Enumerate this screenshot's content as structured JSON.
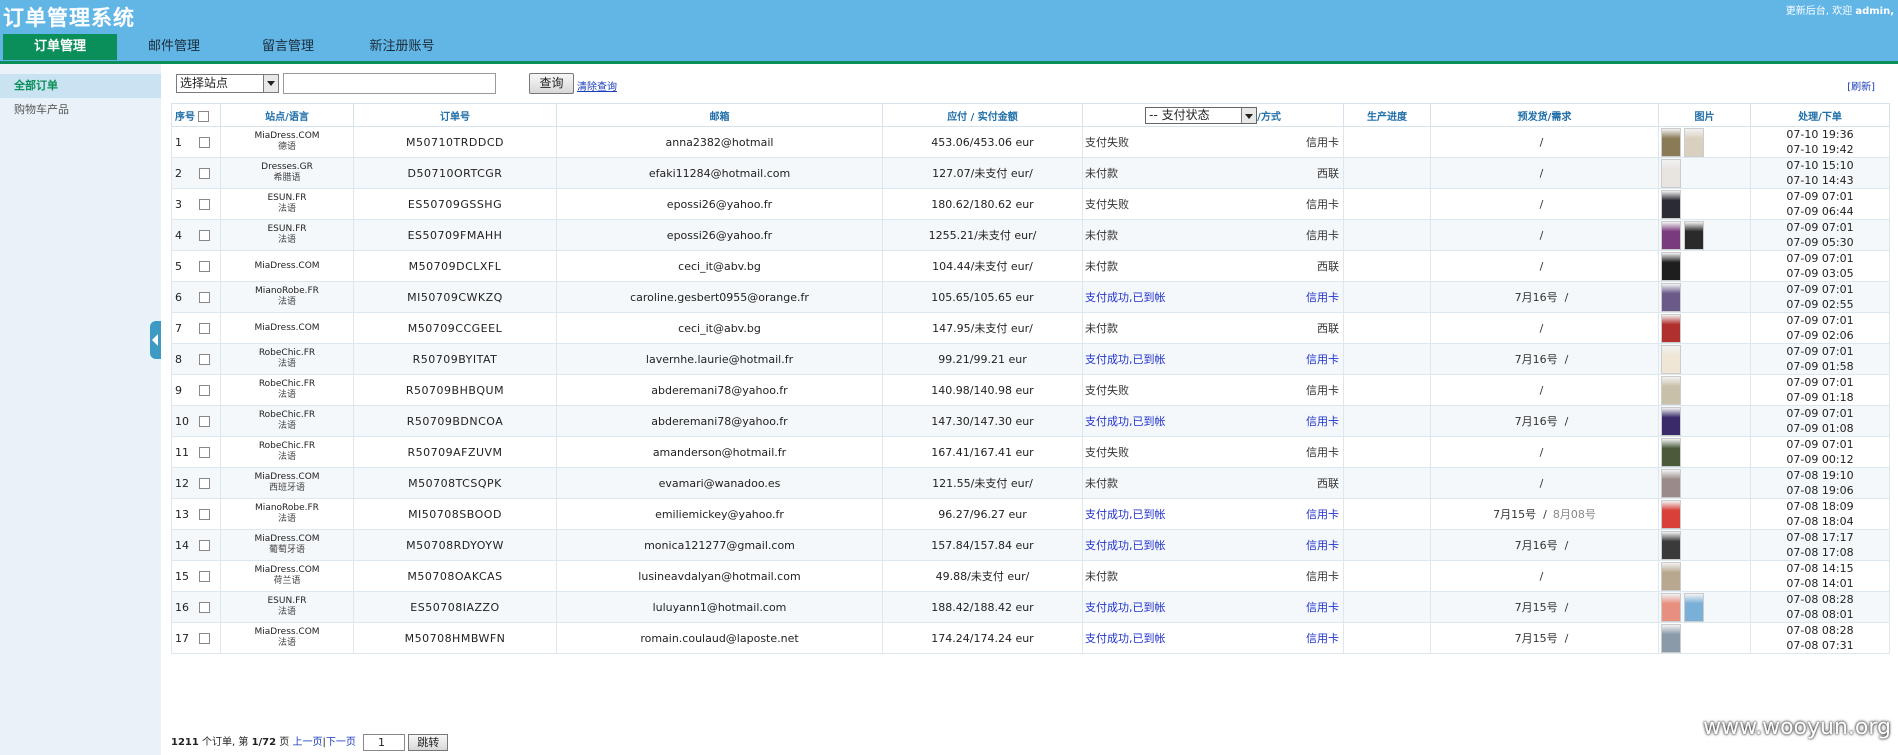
{
  "app": {
    "title": "订单管理系统",
    "top_right_prefix": "更新后台,  欢迎",
    "user": "admin,"
  },
  "nav": {
    "tabs": [
      "订单管理",
      "邮件管理",
      "留言管理",
      "新注册账号"
    ]
  },
  "sidebar": {
    "items": [
      "全部订单",
      "购物车产品"
    ]
  },
  "toolbar": {
    "site_select": "选择站点",
    "search_value": "",
    "query_button": "查询",
    "clear_link": "清除查询",
    "refresh_link": "[刷新]"
  },
  "table": {
    "headers": {
      "seq": "序号",
      "site": "站点/语言",
      "order_no": "订单号",
      "email": "邮箱",
      "amount": "应付 / 实付金额",
      "pay_status_select": "-- 支付状态",
      "pay_method": "/方式",
      "progress": "生产进度",
      "ship": "预发货/需求",
      "images": "图片",
      "time": "处理/下单"
    },
    "rows": [
      {
        "seq": "1",
        "site": "MiaDress.COM",
        "lang": "德语",
        "order_no": "M50710TRDDCD",
        "email": "anna2382@hotmail",
        "amount": "453.06/453.06 eur",
        "pay_status": "支付失败",
        "pay_method": "信用卡",
        "ok": false,
        "ship": "/",
        "ship_est": "",
        "thumbs": [
          "#8a7a55",
          "#d9d0c0"
        ],
        "time1": "07-10 19:36",
        "time2": "07-10 19:42"
      },
      {
        "seq": "2",
        "site": "Dresses.GR",
        "lang": "希腊语",
        "order_no": "D50710ORTCGR",
        "email": "efaki11284@hotmail.com",
        "amount": "127.07/未支付 eur/",
        "pay_status": "未付款",
        "pay_method": "西联",
        "ok": false,
        "ship": "/",
        "ship_est": "",
        "thumbs": [
          "#e8e4e0"
        ],
        "time1": "07-10 15:10",
        "time2": "07-10 14:43"
      },
      {
        "seq": "3",
        "site": "ESUN.FR",
        "lang": "法语",
        "order_no": "ES50709GSSHG",
        "email": "epossi26@yahoo.fr",
        "amount": "180.62/180.62 eur",
        "pay_status": "支付失败",
        "pay_method": "信用卡",
        "ok": false,
        "ship": "/",
        "ship_est": "",
        "thumbs": [
          "#2b2b33"
        ],
        "time1": "07-09 07:01",
        "time2": "07-09 06:44"
      },
      {
        "seq": "4",
        "site": "ESUN.FR",
        "lang": "法语",
        "order_no": "ES50709FMAHH",
        "email": "epossi26@yahoo.fr",
        "amount": "1255.21/未支付 eur/",
        "pay_status": "未付款",
        "pay_method": "信用卡",
        "ok": false,
        "ship": "/",
        "ship_est": "",
        "thumbs": [
          "#7a3a7e",
          "#2a2a2a"
        ],
        "time1": "07-09 07:01",
        "time2": "07-09 05:30"
      },
      {
        "seq": "5",
        "site": "MiaDress.COM",
        "lang": "",
        "order_no": "M50709DCLXFL",
        "email": "ceci_it@abv.bg",
        "amount": "104.44/未支付 eur/",
        "pay_status": "未付款",
        "pay_method": "西联",
        "ok": false,
        "ship": "/",
        "ship_est": "",
        "thumbs": [
          "#1e1e1e"
        ],
        "time1": "07-09 07:01",
        "time2": "07-09 03:05"
      },
      {
        "seq": "6",
        "site": "MianoRobe.FR",
        "lang": "法语",
        "order_no": "MI50709CWKZQ",
        "email": "caroline.gesbert0955@orange.fr",
        "amount": "105.65/105.65 eur",
        "pay_status": "支付成功,已到帐",
        "pay_method": "信用卡",
        "ok": true,
        "ship": "7月16号",
        "ship_est": "",
        "thumbs": [
          "#6a5a8a"
        ],
        "time1": "07-09 07:01",
        "time2": "07-09 02:55"
      },
      {
        "seq": "7",
        "site": "MiaDress.COM",
        "lang": "",
        "order_no": "M50709CCGEEL",
        "email": "ceci_it@abv.bg",
        "amount": "147.95/未支付 eur/",
        "pay_status": "未付款",
        "pay_method": "西联",
        "ok": false,
        "ship": "/",
        "ship_est": "",
        "thumbs": [
          "#b0302e"
        ],
        "time1": "07-09 07:01",
        "time2": "07-09 02:06"
      },
      {
        "seq": "8",
        "site": "RobeChic.FR",
        "lang": "法语",
        "order_no": "R50709BYITAT",
        "email": "lavernhe.laurie@hotmail.fr",
        "amount": "99.21/99.21 eur",
        "pay_status": "支付成功,已到帐",
        "pay_method": "信用卡",
        "ok": true,
        "ship": "7月16号",
        "ship_est": "",
        "thumbs": [
          "#efe6d6"
        ],
        "time1": "07-09 07:01",
        "time2": "07-09 01:58"
      },
      {
        "seq": "9",
        "site": "RobeChic.FR",
        "lang": "法语",
        "order_no": "R50709BHBQUM",
        "email": "abderemani78@yahoo.fr",
        "amount": "140.98/140.98 eur",
        "pay_status": "支付失败",
        "pay_method": "信用卡",
        "ok": false,
        "ship": "/",
        "ship_est": "",
        "thumbs": [
          "#c8c0a8"
        ],
        "time1": "07-09 07:01",
        "time2": "07-09 01:18"
      },
      {
        "seq": "10",
        "site": "RobeChic.FR",
        "lang": "法语",
        "order_no": "R50709BDNCOA",
        "email": "abderemani78@yahoo.fr",
        "amount": "147.30/147.30 eur",
        "pay_status": "支付成功,已到帐",
        "pay_method": "信用卡",
        "ok": true,
        "ship": "7月16号",
        "ship_est": "",
        "thumbs": [
          "#3a2a6a"
        ],
        "time1": "07-09 07:01",
        "time2": "07-09 01:08"
      },
      {
        "seq": "11",
        "site": "RobeChic.FR",
        "lang": "法语",
        "order_no": "R50709AFZUVM",
        "email": "amanderson@hotmail.fr",
        "amount": "167.41/167.41 eur",
        "pay_status": "支付失败",
        "pay_method": "信用卡",
        "ok": false,
        "ship": "/",
        "ship_est": "",
        "thumbs": [
          "#4a5a3a"
        ],
        "time1": "07-09 07:01",
        "time2": "07-09 00:12"
      },
      {
        "seq": "12",
        "site": "MiaDress.COM",
        "lang": "西班牙语",
        "order_no": "M50708TCSQPK",
        "email": "evamari@wanadoo.es",
        "amount": "121.55/未支付 eur/",
        "pay_status": "未付款",
        "pay_method": "西联",
        "ok": false,
        "ship": "/",
        "ship_est": "",
        "thumbs": [
          "#9a8a8a"
        ],
        "time1": "07-08 19:10",
        "time2": "07-08 19:06"
      },
      {
        "seq": "13",
        "site": "MianoRobe.FR",
        "lang": "法语",
        "order_no": "MI50708SBOOD",
        "email": "emiliemickey@yahoo.fr",
        "amount": "96.27/96.27 eur",
        "pay_status": "支付成功,已到帐",
        "pay_method": "信用卡",
        "ok": true,
        "ship": "7月15号",
        "ship_est": "8月08号",
        "thumbs": [
          "#d8403a"
        ],
        "time1": "07-08 18:09",
        "time2": "07-08 18:04"
      },
      {
        "seq": "14",
        "site": "MiaDress.COM",
        "lang": "葡萄牙语",
        "order_no": "M50708RDYOYW",
        "email": "monica121277@gmail.com",
        "amount": "157.84/157.84 eur",
        "pay_status": "支付成功,已到帐",
        "pay_method": "信用卡",
        "ok": true,
        "ship": "7月16号",
        "ship_est": "",
        "thumbs": [
          "#3a3a3a"
        ],
        "time1": "07-08 17:17",
        "time2": "07-08 17:08"
      },
      {
        "seq": "15",
        "site": "MiaDress.COM",
        "lang": "荷兰语",
        "order_no": "M50708OAKCAS",
        "email": "lusineavdalyan@hotmail.com",
        "amount": "49.88/未支付 eur/",
        "pay_status": "未付款",
        "pay_method": "信用卡",
        "ok": false,
        "ship": "/",
        "ship_est": "",
        "thumbs": [
          "#b8a890"
        ],
        "time1": "07-08 14:15",
        "time2": "07-08 14:01"
      },
      {
        "seq": "16",
        "site": "ESUN.FR",
        "lang": "法语",
        "order_no": "ES50708IAZZO",
        "email": "luluyann1@hotmail.com",
        "amount": "188.42/188.42 eur",
        "pay_status": "支付成功,已到帐",
        "pay_method": "信用卡",
        "ok": true,
        "ship": "7月15号",
        "ship_est": "",
        "thumbs": [
          "#e89080",
          "#7ab0d8"
        ],
        "time1": "07-08 08:28",
        "time2": "07-08 08:01"
      },
      {
        "seq": "17",
        "site": "MiaDress.COM",
        "lang": "法语",
        "order_no": "M50708HMBWFN",
        "email": "romain.coulaud@laposte.net",
        "amount": "174.24/174.24 eur",
        "pay_status": "支付成功,已到帐",
        "pay_method": "信用卡",
        "ok": true,
        "ship": "7月15号",
        "ship_est": "",
        "thumbs": [
          "#8a9aa8"
        ],
        "time1": "07-08 08:28",
        "time2": "07-08 07:31"
      }
    ]
  },
  "footer": {
    "total": "1211",
    "text1": " 个订单, 第 ",
    "page": "1/72",
    "text2": " 页 ",
    "prev": "上一页",
    "next": "下一页",
    "page_input": "1",
    "jump": "跳转"
  },
  "watermark": "www.wooyun.org"
}
